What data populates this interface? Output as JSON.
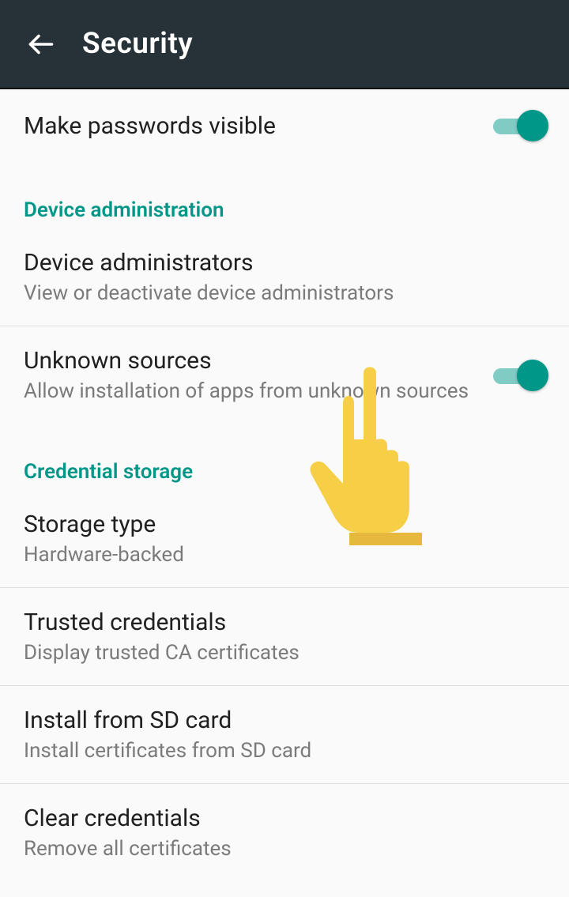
{
  "appbar": {
    "title": "Security"
  },
  "items": {
    "make_passwords_visible": {
      "title": "Make passwords visible"
    },
    "device_admin_header": "Device administration",
    "device_administrators": {
      "title": "Device administrators",
      "subtitle": "View or deactivate device administrators"
    },
    "unknown_sources": {
      "title": "Unknown sources",
      "subtitle": "Allow installation of apps from unknown sources"
    },
    "credential_storage_header": "Credential storage",
    "storage_type": {
      "title": "Storage type",
      "subtitle": "Hardware-backed"
    },
    "trusted_credentials": {
      "title": "Trusted credentials",
      "subtitle": "Display trusted CA certificates"
    },
    "install_sd": {
      "title": "Install from SD card",
      "subtitle": "Install certificates from SD card"
    },
    "clear_credentials": {
      "title": "Clear credentials",
      "subtitle": "Remove all certificates"
    }
  }
}
